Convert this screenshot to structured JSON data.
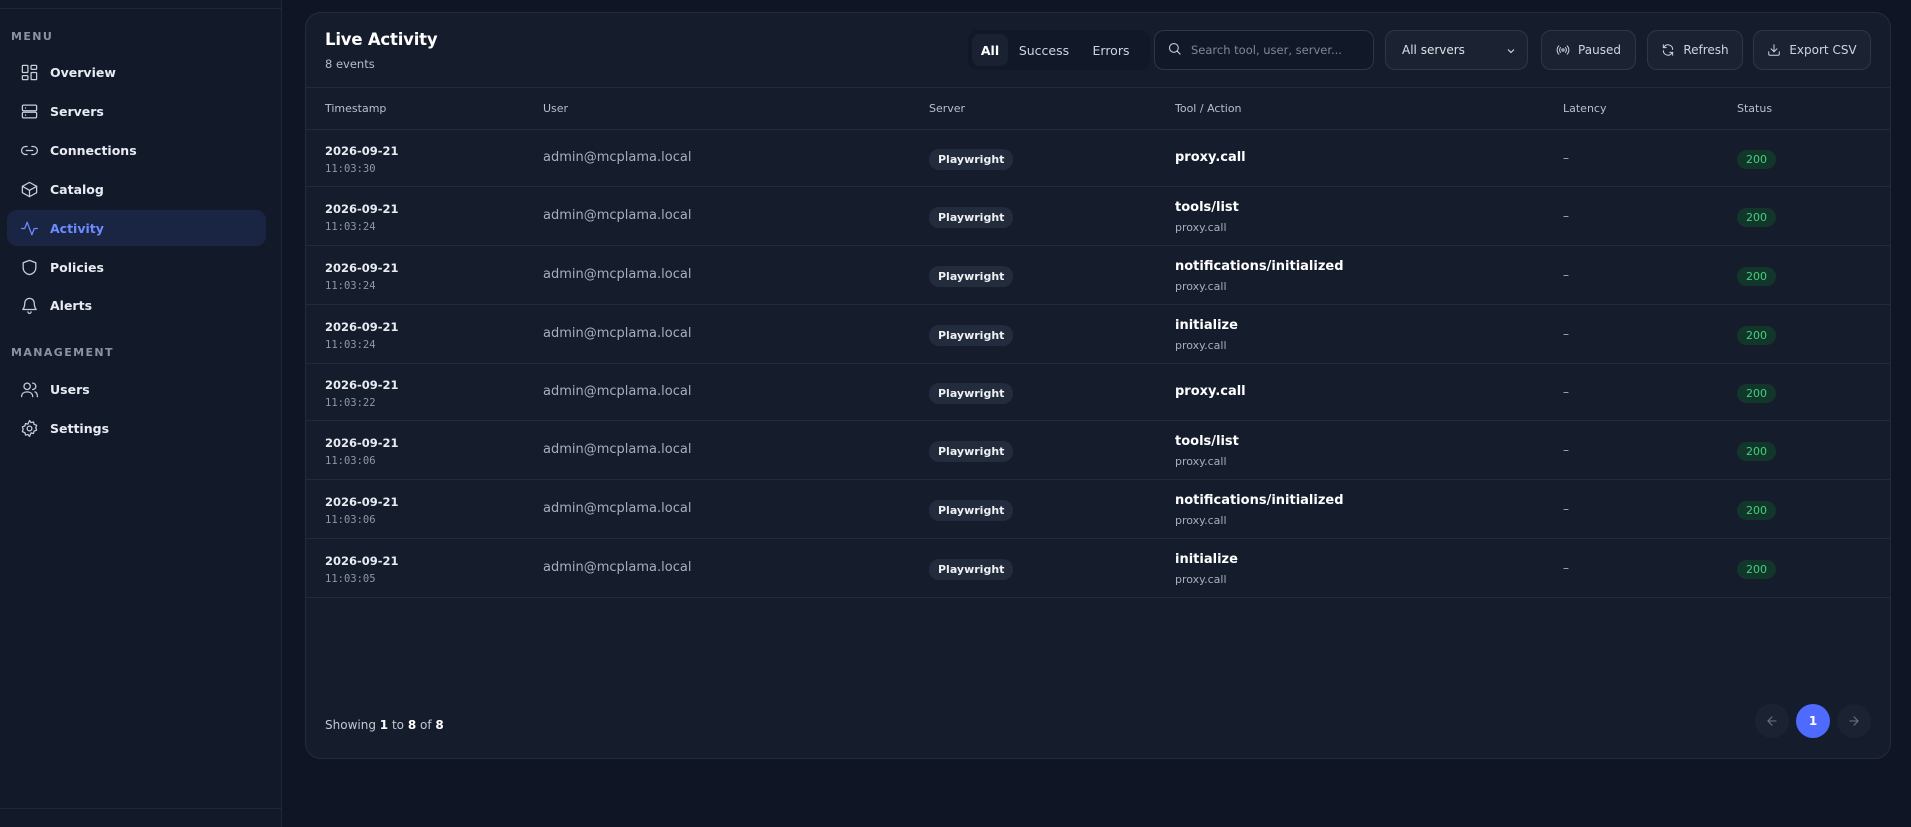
{
  "sidebar": {
    "menu_label": "MENU",
    "management_label": "MANAGEMENT",
    "menu_items": [
      {
        "label": "Overview",
        "icon": "grid-icon"
      },
      {
        "label": "Servers",
        "icon": "server-icon"
      },
      {
        "label": "Connections",
        "icon": "link-icon"
      },
      {
        "label": "Catalog",
        "icon": "box-icon"
      },
      {
        "label": "Activity",
        "icon": "activity-icon",
        "active": true
      },
      {
        "label": "Policies",
        "icon": "shield-icon"
      },
      {
        "label": "Alerts",
        "icon": "bell-icon"
      }
    ],
    "management_items": [
      {
        "label": "Users",
        "icon": "users-icon"
      },
      {
        "label": "Settings",
        "icon": "gear-icon"
      }
    ]
  },
  "header": {
    "title": "Live Activity",
    "subtitle": "8 events",
    "filters": [
      "All",
      "Success",
      "Errors"
    ],
    "search_placeholder": "Search tool, user, server...",
    "server_select": "All servers",
    "paused_label": "Paused",
    "refresh_label": "Refresh",
    "export_label": "Export CSV"
  },
  "table": {
    "columns": [
      "Timestamp",
      "User",
      "Server",
      "Tool / Action",
      "Latency",
      "Status"
    ],
    "rows": [
      {
        "date": "2026-09-21",
        "time": "11:03:30",
        "user": "admin@mcplama.local",
        "server": "Playwright",
        "tool": "proxy.call",
        "sub": "",
        "latency": "–",
        "status": "200"
      },
      {
        "date": "2026-09-21",
        "time": "11:03:24",
        "user": "admin@mcplama.local",
        "server": "Playwright",
        "tool": "tools/list",
        "sub": "proxy.call",
        "latency": "–",
        "status": "200"
      },
      {
        "date": "2026-09-21",
        "time": "11:03:24",
        "user": "admin@mcplama.local",
        "server": "Playwright",
        "tool": "notifications/initialized",
        "sub": "proxy.call",
        "latency": "–",
        "status": "200"
      },
      {
        "date": "2026-09-21",
        "time": "11:03:24",
        "user": "admin@mcplama.local",
        "server": "Playwright",
        "tool": "initialize",
        "sub": "proxy.call",
        "latency": "–",
        "status": "200"
      },
      {
        "date": "2026-09-21",
        "time": "11:03:22",
        "user": "admin@mcplama.local",
        "server": "Playwright",
        "tool": "proxy.call",
        "sub": "",
        "latency": "–",
        "status": "200"
      },
      {
        "date": "2026-09-21",
        "time": "11:03:06",
        "user": "admin@mcplama.local",
        "server": "Playwright",
        "tool": "tools/list",
        "sub": "proxy.call",
        "latency": "–",
        "status": "200"
      },
      {
        "date": "2026-09-21",
        "time": "11:03:06",
        "user": "admin@mcplama.local",
        "server": "Playwright",
        "tool": "notifications/initialized",
        "sub": "proxy.call",
        "latency": "–",
        "status": "200"
      },
      {
        "date": "2026-09-21",
        "time": "11:03:05",
        "user": "admin@mcplama.local",
        "server": "Playwright",
        "tool": "initialize",
        "sub": "proxy.call",
        "latency": "–",
        "status": "200"
      }
    ]
  },
  "footer": {
    "showing_prefix": "Showing",
    "from": "1",
    "to_word": "to",
    "to": "8",
    "of_word": "of",
    "total": "8",
    "current_page": "1"
  }
}
